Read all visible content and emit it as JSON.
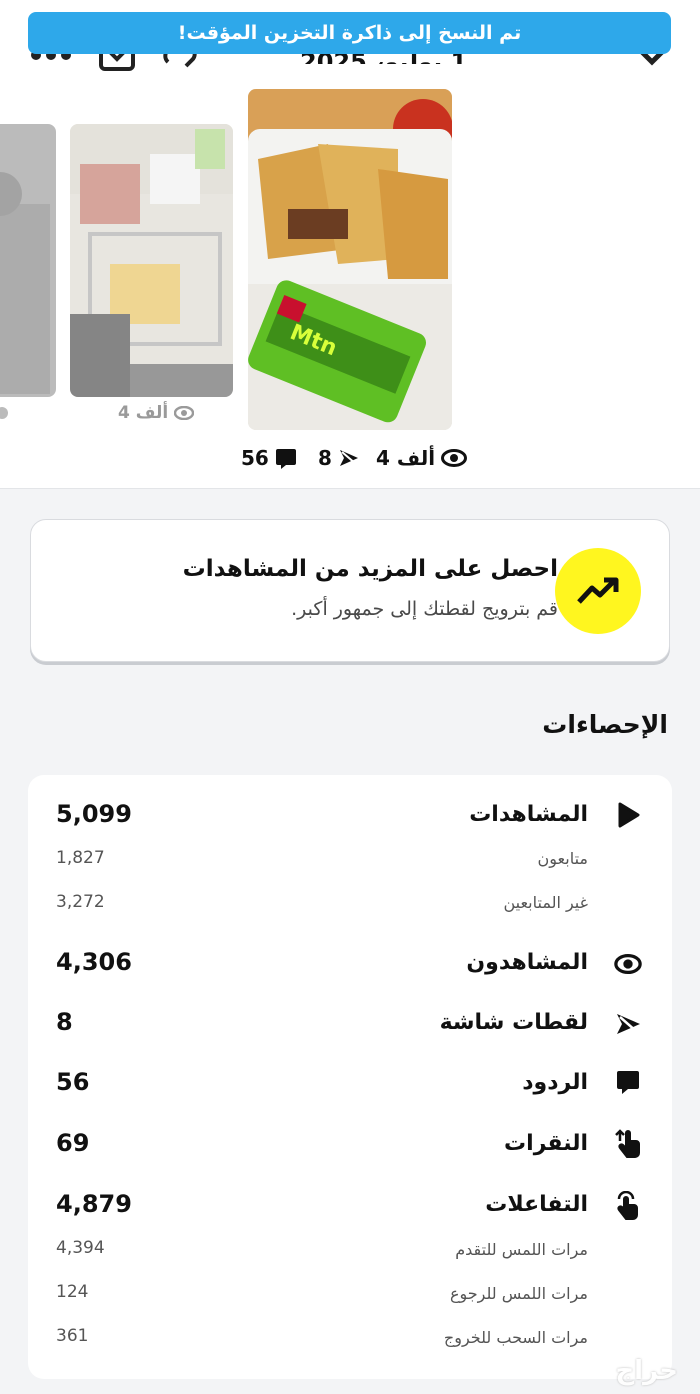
{
  "toast": {
    "text": "تم النسخ إلى ذاكرة التخزين المؤقت!"
  },
  "header": {
    "date": "1 يوليو، 2025"
  },
  "snaps": {
    "main": {
      "views": "4 ألف",
      "screenshots": "8",
      "replies": "56"
    },
    "second": {
      "views": "4 ألف"
    }
  },
  "promo": {
    "title": "احصل على المزيد من المشاهدات",
    "subtitle": "قم بترويج لقطتك إلى جمهور أكبر."
  },
  "stats": {
    "title": "الإحصاءات",
    "views": {
      "label": "المشاهدات",
      "value": "5,099"
    },
    "followers": {
      "label": "متابعون",
      "value": "1,827"
    },
    "non_followers": {
      "label": "غير المتابعين",
      "value": "3,272"
    },
    "viewers": {
      "label": "المشاهدون",
      "value": "4,306"
    },
    "screenshots": {
      "label": "لقطات شاشة",
      "value": "8"
    },
    "replies": {
      "label": "الردود",
      "value": "56"
    },
    "taps": {
      "label": "النقرات",
      "value": "69"
    },
    "interactions": {
      "label": "التفاعلات",
      "value": "4,879"
    },
    "tap_forward": {
      "label": "مرات اللمس للتقدم",
      "value": "4,394"
    },
    "tap_back": {
      "label": "مرات اللمس للرجوع",
      "value": "124"
    },
    "swipe_exit": {
      "label": "مرات السحب للخروج",
      "value": "361"
    }
  },
  "watermark": {
    "text": "حراج"
  },
  "colors": {
    "toast": "#2ea8ea",
    "promo_icon_bg": "#fff61f",
    "page_bg": "#f3f4f6"
  }
}
